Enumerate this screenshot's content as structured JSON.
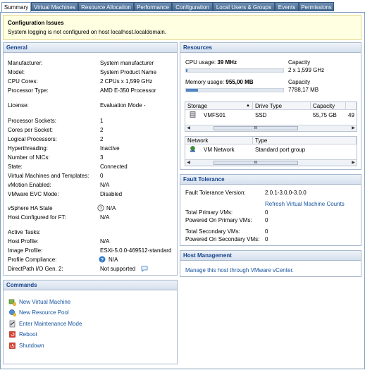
{
  "tabs": [
    {
      "label": "Summary",
      "active": true
    },
    {
      "label": "Virtual Machines",
      "active": false
    },
    {
      "label": "Resource Allocation",
      "active": false
    },
    {
      "label": "Performance",
      "active": false
    },
    {
      "label": "Configuration",
      "active": false
    },
    {
      "label": "Local Users & Groups",
      "active": false
    },
    {
      "label": "Events",
      "active": false
    },
    {
      "label": "Permissions",
      "active": false
    }
  ],
  "config_issues": {
    "title": "Configuration Issues",
    "message": "System logging is not configured on host localhost.localdomain."
  },
  "general": {
    "title": "General",
    "rows": [
      {
        "label": "Manufacturer:",
        "value": "System manufacturer"
      },
      {
        "label": "Model:",
        "value": "System Product Name"
      },
      {
        "label": "CPU Cores:",
        "value": "2 CPUs x 1,599 GHz"
      },
      {
        "label": "Processor Type:",
        "value": "AMD E-350 Processor"
      },
      {
        "label": "License:",
        "value": "Evaluation Mode -"
      },
      {
        "label": "Processor Sockets:",
        "value": "1"
      },
      {
        "label": "Cores per Socket:",
        "value": "2"
      },
      {
        "label": "Logical Processors:",
        "value": "2"
      },
      {
        "label": "Hyperthreading:",
        "value": "Inactive"
      },
      {
        "label": "Number of NICs:",
        "value": "3"
      },
      {
        "label": "State:",
        "value": "Connected"
      },
      {
        "label": "Virtual Machines and Templates:",
        "value": "0"
      },
      {
        "label": "vMotion Enabled:",
        "value": "N/A"
      },
      {
        "label": "VMware EVC Mode:",
        "value": "Disabled"
      },
      {
        "label": "vSphere HA State",
        "value": "N/A"
      },
      {
        "label": "Host Configured for FT:",
        "value": "N/A"
      },
      {
        "label": "Active Tasks:",
        "value": ""
      },
      {
        "label": "Host Profile:",
        "value": "N/A"
      },
      {
        "label": "Image Profile:",
        "value": "ESXi-5.0.0-469512-standard"
      },
      {
        "label": "Profile Compliance:",
        "value": "N/A"
      },
      {
        "label": "DirectPath I/O Gen. 2:",
        "value": "Not supported"
      }
    ]
  },
  "commands": {
    "title": "Commands",
    "items": [
      {
        "label": "New Virtual Machine",
        "icon": "new-vm-icon"
      },
      {
        "label": "New Resource Pool",
        "icon": "resource-pool-icon"
      },
      {
        "label": "Enter Maintenance Mode",
        "icon": "maintenance-icon"
      },
      {
        "label": "Reboot",
        "icon": "reboot-icon"
      },
      {
        "label": "Shutdown",
        "icon": "shutdown-icon"
      }
    ]
  },
  "resources": {
    "title": "Resources",
    "cpu_label": "CPU usage:",
    "cpu_value": "39 MHz",
    "cpu_fraction": 0.012,
    "cpu_cap_label": "Capacity",
    "cpu_cap_value": "2 x 1,599 GHz",
    "mem_label": "Memory usage:",
    "mem_value": "955,00 MB",
    "mem_fraction": 0.123,
    "mem_cap_label": "Capacity",
    "mem_cap_value": "7788,17 MB",
    "storage_headers": [
      "Storage",
      "Drive Type",
      "Capacity",
      ""
    ],
    "storage_row": {
      "name": "VMFS01",
      "type": "SSD",
      "capacity": "55,75 GB",
      "extra": "49"
    },
    "network_headers": [
      "Network",
      "Type"
    ],
    "network_row": {
      "name": "VM Network",
      "type": "Standard port group"
    },
    "thumb_glyph": "III"
  },
  "fault_tolerance": {
    "title": "Fault Tolerance",
    "version_label": "Fault Tolerance Version:",
    "version_value": "2.0.1-3.0.0-3.0.0",
    "refresh_link": "Refresh Virtual Machine Counts",
    "rows": [
      {
        "label": "Total Primary VMs:",
        "value": "0"
      },
      {
        "label": "Powered On Primary VMs:",
        "value": "0"
      },
      {
        "label": "Total Secondary VMs:",
        "value": "0"
      },
      {
        "label": "Powered On Secondary VMs:",
        "value": "0"
      }
    ]
  },
  "host_management": {
    "title": "Host Management",
    "link": "Manage this host through VMware vCenter."
  }
}
